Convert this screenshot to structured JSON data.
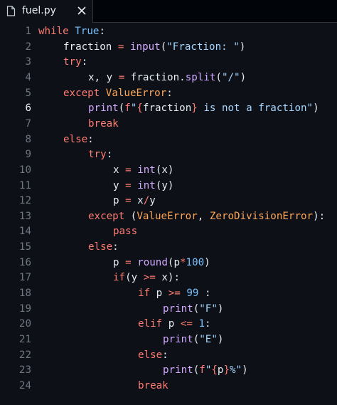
{
  "tab": {
    "filename": "fuel.py",
    "close_symbol": "✕"
  },
  "editor": {
    "active_line": 6,
    "lines": [
      {
        "n": "1",
        "indent": 0,
        "tokens": [
          {
            "t": "while",
            "c": "kw"
          },
          {
            "t": " ",
            "c": "pl"
          },
          {
            "t": "True",
            "c": "bi"
          },
          {
            "t": ":",
            "c": "pl"
          }
        ]
      },
      {
        "n": "2",
        "indent": 1,
        "tokens": [
          {
            "t": "fraction",
            "c": "pl"
          },
          {
            "t": " ",
            "c": "pl"
          },
          {
            "t": "=",
            "c": "op"
          },
          {
            "t": " ",
            "c": "pl"
          },
          {
            "t": "input",
            "c": "fn"
          },
          {
            "t": "(",
            "c": "pl"
          },
          {
            "t": "\"Fraction: \"",
            "c": "str"
          },
          {
            "t": ")",
            "c": "pl"
          }
        ]
      },
      {
        "n": "3",
        "indent": 1,
        "tokens": [
          {
            "t": "try",
            "c": "kw"
          },
          {
            "t": ":",
            "c": "pl"
          }
        ]
      },
      {
        "n": "4",
        "indent": 2,
        "tokens": [
          {
            "t": "x, y",
            "c": "pl"
          },
          {
            "t": " ",
            "c": "pl"
          },
          {
            "t": "=",
            "c": "op"
          },
          {
            "t": " fraction.",
            "c": "pl"
          },
          {
            "t": "split",
            "c": "fn"
          },
          {
            "t": "(",
            "c": "pl"
          },
          {
            "t": "\"/\"",
            "c": "str"
          },
          {
            "t": ")",
            "c": "pl"
          }
        ]
      },
      {
        "n": "5",
        "indent": 1,
        "tokens": [
          {
            "t": "except",
            "c": "kw"
          },
          {
            "t": " ",
            "c": "pl"
          },
          {
            "t": "ValueError",
            "c": "var"
          },
          {
            "t": ":",
            "c": "pl"
          }
        ]
      },
      {
        "n": "6",
        "indent": 2,
        "tokens": [
          {
            "t": "print",
            "c": "fn"
          },
          {
            "t": "(",
            "c": "pl"
          },
          {
            "t": "f",
            "c": "kw"
          },
          {
            "t": "\"",
            "c": "str"
          },
          {
            "t": "{",
            "c": "op"
          },
          {
            "t": "fraction",
            "c": "pl"
          },
          {
            "t": "}",
            "c": "op"
          },
          {
            "t": " is not a fraction\"",
            "c": "str"
          },
          {
            "t": ")",
            "c": "pl"
          }
        ]
      },
      {
        "n": "7",
        "indent": 2,
        "tokens": [
          {
            "t": "break",
            "c": "kw"
          }
        ]
      },
      {
        "n": "8",
        "indent": 1,
        "tokens": [
          {
            "t": "else",
            "c": "kw"
          },
          {
            "t": ":",
            "c": "pl"
          }
        ]
      },
      {
        "n": "9",
        "indent": 2,
        "tokens": [
          {
            "t": "try",
            "c": "kw"
          },
          {
            "t": ":",
            "c": "pl"
          }
        ]
      },
      {
        "n": "10",
        "indent": 3,
        "tokens": [
          {
            "t": "x",
            "c": "pl"
          },
          {
            "t": " ",
            "c": "pl"
          },
          {
            "t": "=",
            "c": "op"
          },
          {
            "t": " ",
            "c": "pl"
          },
          {
            "t": "int",
            "c": "fn"
          },
          {
            "t": "(x)",
            "c": "pl"
          }
        ]
      },
      {
        "n": "11",
        "indent": 3,
        "tokens": [
          {
            "t": "y",
            "c": "pl"
          },
          {
            "t": " ",
            "c": "pl"
          },
          {
            "t": "=",
            "c": "op"
          },
          {
            "t": " ",
            "c": "pl"
          },
          {
            "t": "int",
            "c": "fn"
          },
          {
            "t": "(y)",
            "c": "pl"
          }
        ]
      },
      {
        "n": "12",
        "indent": 3,
        "tokens": [
          {
            "t": "p",
            "c": "pl"
          },
          {
            "t": " ",
            "c": "pl"
          },
          {
            "t": "=",
            "c": "op"
          },
          {
            "t": " x",
            "c": "pl"
          },
          {
            "t": "/",
            "c": "op"
          },
          {
            "t": "y",
            "c": "pl"
          }
        ]
      },
      {
        "n": "13",
        "indent": 2,
        "tokens": [
          {
            "t": "except",
            "c": "kw"
          },
          {
            "t": " (",
            "c": "pl"
          },
          {
            "t": "ValueError",
            "c": "var"
          },
          {
            "t": ", ",
            "c": "pl"
          },
          {
            "t": "ZeroDivisionError",
            "c": "var"
          },
          {
            "t": "):",
            "c": "pl"
          }
        ]
      },
      {
        "n": "14",
        "indent": 3,
        "tokens": [
          {
            "t": "pass",
            "c": "kw"
          }
        ]
      },
      {
        "n": "15",
        "indent": 2,
        "tokens": [
          {
            "t": "else",
            "c": "kw"
          },
          {
            "t": ":",
            "c": "pl"
          }
        ]
      },
      {
        "n": "16",
        "indent": 3,
        "tokens": [
          {
            "t": "p",
            "c": "pl"
          },
          {
            "t": " ",
            "c": "pl"
          },
          {
            "t": "=",
            "c": "op"
          },
          {
            "t": " ",
            "c": "pl"
          },
          {
            "t": "round",
            "c": "fn"
          },
          {
            "t": "(p",
            "c": "pl"
          },
          {
            "t": "*",
            "c": "op"
          },
          {
            "t": "100",
            "c": "num"
          },
          {
            "t": ")",
            "c": "pl"
          }
        ]
      },
      {
        "n": "17",
        "indent": 3,
        "tokens": [
          {
            "t": "if",
            "c": "kw"
          },
          {
            "t": "(y",
            "c": "pl"
          },
          {
            "t": " ",
            "c": "pl"
          },
          {
            "t": ">=",
            "c": "op"
          },
          {
            "t": " x):",
            "c": "pl"
          }
        ]
      },
      {
        "n": "18",
        "indent": 4,
        "tokens": [
          {
            "t": "if",
            "c": "kw"
          },
          {
            "t": " p",
            "c": "pl"
          },
          {
            "t": " ",
            "c": "pl"
          },
          {
            "t": ">=",
            "c": "op"
          },
          {
            "t": " ",
            "c": "pl"
          },
          {
            "t": "99",
            "c": "num"
          },
          {
            "t": " :",
            "c": "pl"
          }
        ]
      },
      {
        "n": "19",
        "indent": 5,
        "tokens": [
          {
            "t": "print",
            "c": "fn"
          },
          {
            "t": "(",
            "c": "pl"
          },
          {
            "t": "\"F\"",
            "c": "str"
          },
          {
            "t": ")",
            "c": "pl"
          }
        ]
      },
      {
        "n": "20",
        "indent": 4,
        "tokens": [
          {
            "t": "elif",
            "c": "kw"
          },
          {
            "t": " p",
            "c": "pl"
          },
          {
            "t": " ",
            "c": "pl"
          },
          {
            "t": "<=",
            "c": "op"
          },
          {
            "t": " ",
            "c": "pl"
          },
          {
            "t": "1",
            "c": "num"
          },
          {
            "t": ":",
            "c": "pl"
          }
        ]
      },
      {
        "n": "21",
        "indent": 5,
        "tokens": [
          {
            "t": "print",
            "c": "fn"
          },
          {
            "t": "(",
            "c": "pl"
          },
          {
            "t": "\"E\"",
            "c": "str"
          },
          {
            "t": ")",
            "c": "pl"
          }
        ]
      },
      {
        "n": "22",
        "indent": 4,
        "tokens": [
          {
            "t": "else",
            "c": "kw"
          },
          {
            "t": ":",
            "c": "pl"
          }
        ]
      },
      {
        "n": "23",
        "indent": 5,
        "tokens": [
          {
            "t": "print",
            "c": "fn"
          },
          {
            "t": "(",
            "c": "pl"
          },
          {
            "t": "f",
            "c": "kw"
          },
          {
            "t": "\"",
            "c": "str"
          },
          {
            "t": "{",
            "c": "op"
          },
          {
            "t": "p",
            "c": "pl"
          },
          {
            "t": "}",
            "c": "op"
          },
          {
            "t": "%\"",
            "c": "str"
          },
          {
            "t": ")",
            "c": "pl"
          }
        ]
      },
      {
        "n": "24",
        "indent": 4,
        "tokens": [
          {
            "t": "break",
            "c": "kw"
          }
        ]
      }
    ]
  }
}
